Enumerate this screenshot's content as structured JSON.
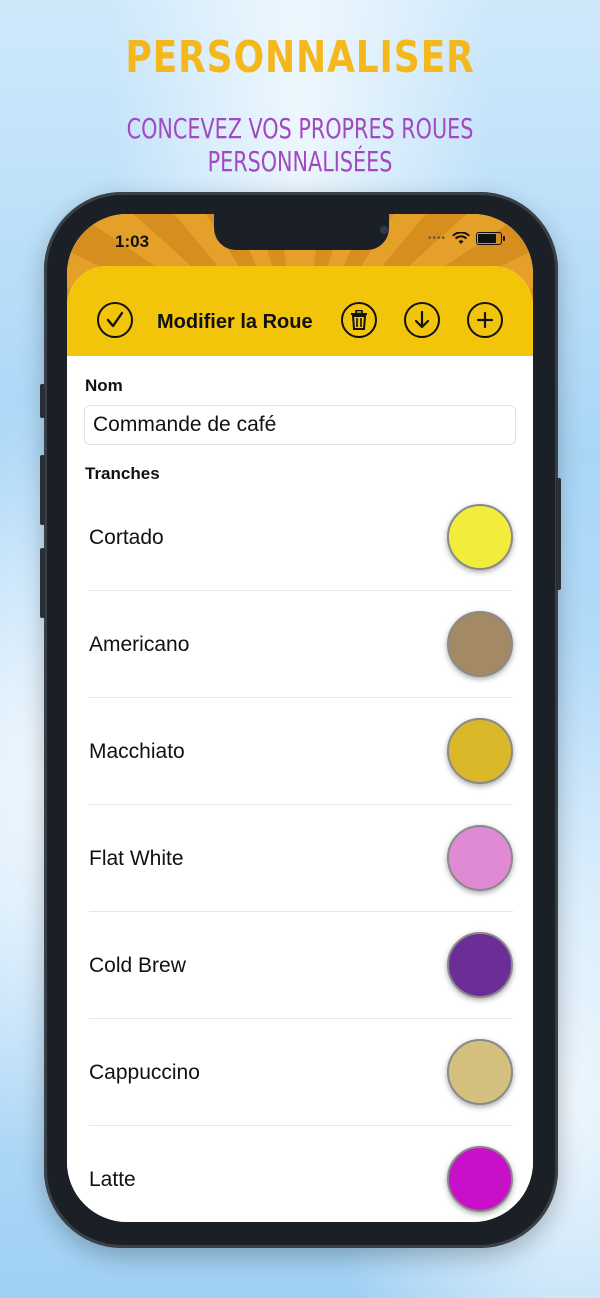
{
  "marketing": {
    "headline": "PERSONNALISER",
    "subhead": "CONCEVEZ VOS PROPRES ROUES PERSONNALISÉES"
  },
  "status_bar": {
    "time": "1:03"
  },
  "toolbar": {
    "title": "Modifier la Roue",
    "icons": [
      "checkmark-circle-icon",
      "trash-circle-icon",
      "download-circle-icon",
      "plus-circle-icon"
    ]
  },
  "form": {
    "name_label": "Nom",
    "name_value": "Commande de café",
    "slices_label": "Tranches"
  },
  "slices": [
    {
      "name": "Cortado",
      "color": "#f2ec3c"
    },
    {
      "name": "Americano",
      "color": "#a48a64"
    },
    {
      "name": "Macchiato",
      "color": "#d9b92a"
    },
    {
      "name": "Flat White",
      "color": "#e08ad6"
    },
    {
      "name": "Cold Brew",
      "color": "#6c2e96"
    },
    {
      "name": "Cappuccino",
      "color": "#d4c07e"
    },
    {
      "name": "Latte",
      "color": "#c810c8"
    }
  ],
  "colors": {
    "headline": "#f5b81c",
    "subhead": "#a248c0",
    "toolbar": "#f3c50a"
  }
}
